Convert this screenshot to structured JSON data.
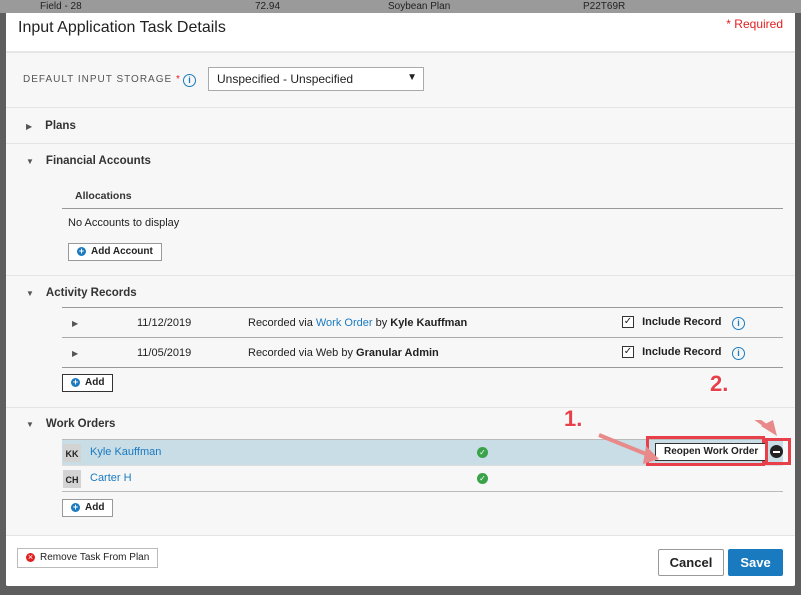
{
  "background": {
    "cells": [
      "Field - 28",
      "72.94",
      "Soybean Plan",
      "P22T69R"
    ]
  },
  "modal": {
    "title": "Input Application Task Details",
    "required_note": "* Required"
  },
  "storage": {
    "label": "DEFAULT INPUT STORAGE",
    "required_mark": "*",
    "value": "Unspecified - Unspecified"
  },
  "sections": {
    "plans": {
      "title": "Plans",
      "expanded": false
    },
    "financial": {
      "title": "Financial Accounts",
      "expanded": true,
      "column": "Allocations",
      "empty": "No Accounts to display",
      "add_label": "Add Account"
    },
    "activity": {
      "title": "Activity Records",
      "expanded": true,
      "add_label": "Add",
      "include_label": "Include Record",
      "rows": [
        {
          "date": "11/12/2019",
          "prefix": "Recorded via ",
          "via": "Work Order",
          "by": " by ",
          "user": "Kyle Kauffman",
          "via_is_link": true,
          "included": true
        },
        {
          "date": "11/05/2019",
          "prefix": "Recorded via ",
          "via": "Web",
          "by": " by ",
          "user": "Granular Admin",
          "via_is_link": false,
          "included": true
        }
      ]
    },
    "work_orders": {
      "title": "Work Orders",
      "expanded": true,
      "add_label": "Add",
      "reopen_label": "Reopen Work Order",
      "rows": [
        {
          "initials": "KK",
          "name": "Kyle Kauffman",
          "status": "complete",
          "selected": true
        },
        {
          "initials": "CH",
          "name": "Carter H",
          "status": "complete",
          "selected": false
        }
      ]
    }
  },
  "annotations": {
    "step1": "1.",
    "step2": "2.",
    "color": "#e8404a"
  },
  "footer": {
    "remove_label": "Remove Task From Plan",
    "cancel_label": "Cancel",
    "save_label": "Save"
  },
  "colors": {
    "accent": "#1a7ac0",
    "selected_row": "#c9dde6",
    "success": "#3aa34a",
    "danger": "#e02020"
  }
}
